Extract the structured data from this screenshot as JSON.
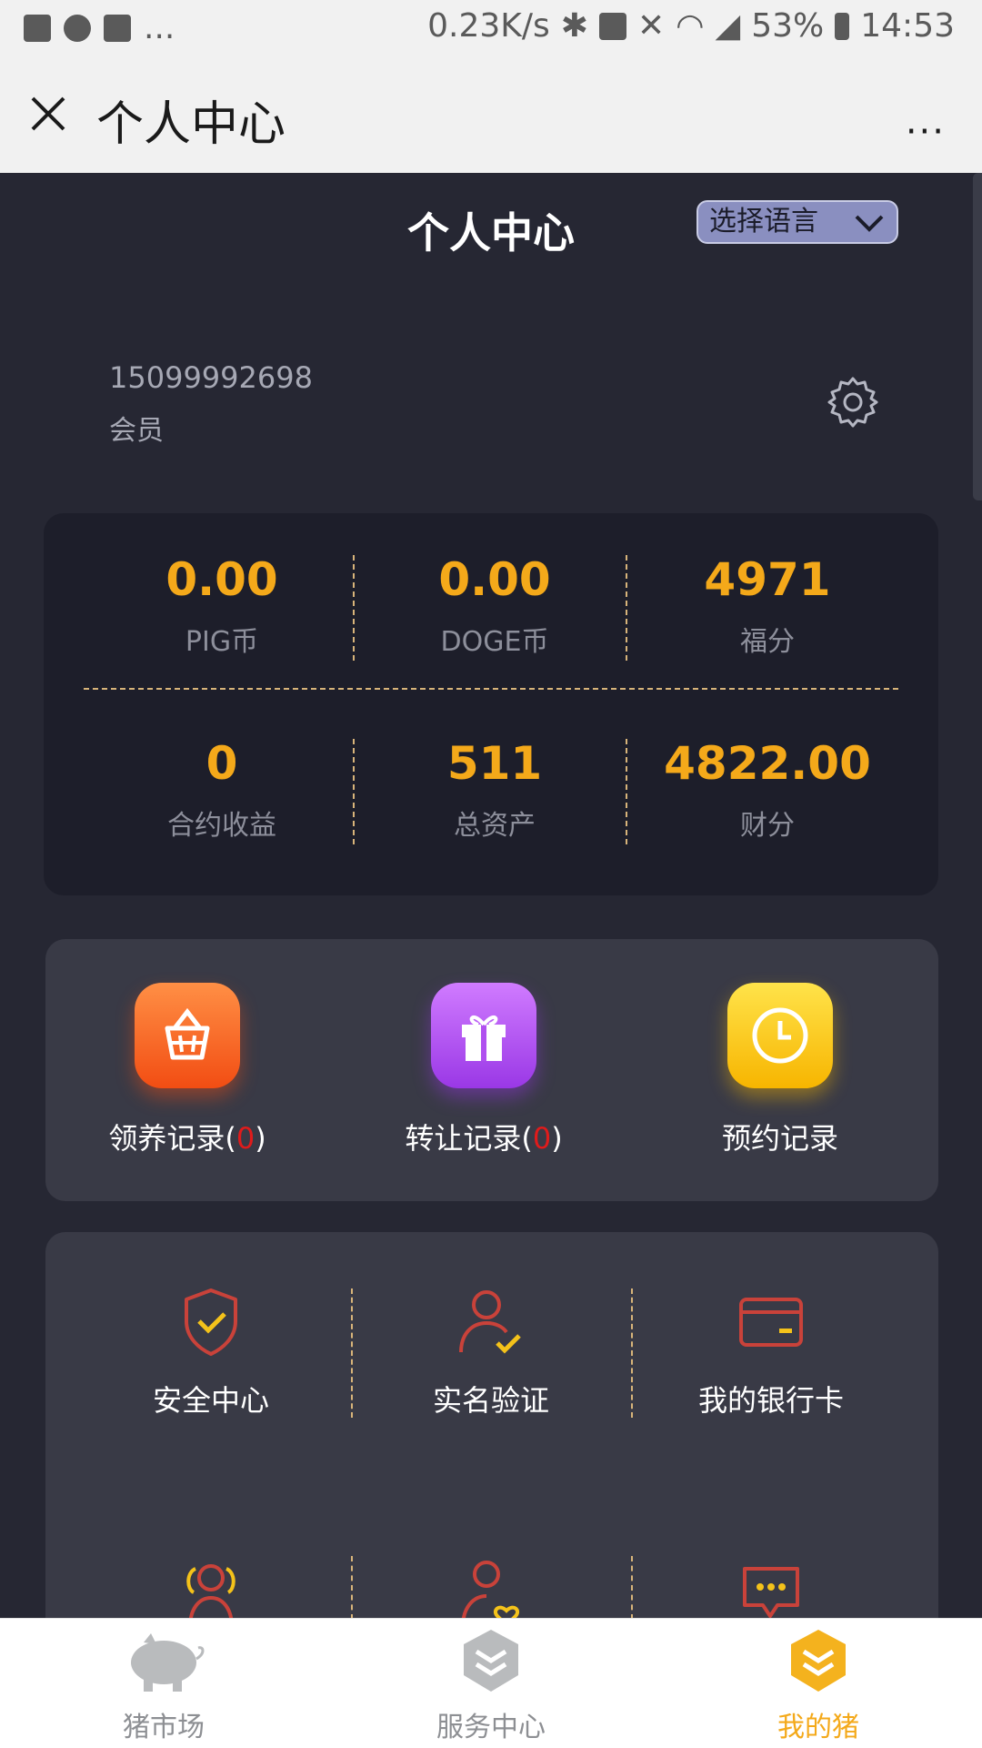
{
  "status_bar": {
    "network_speed": "0.23K/s",
    "battery": "53%",
    "time": "14:53",
    "overflow": "..."
  },
  "nav": {
    "title": "个人中心",
    "more": "···"
  },
  "header": {
    "title": "个人中心",
    "language_select": "选择语言"
  },
  "user": {
    "phone": "15099992698",
    "role": "会员"
  },
  "stats": [
    {
      "value": "0.00",
      "label": "PIG币"
    },
    {
      "value": "0.00",
      "label": "DOGE币"
    },
    {
      "value": "4971",
      "label": "福分"
    },
    {
      "value": "0",
      "label": "合约收益"
    },
    {
      "value": "511",
      "label": "总资产"
    },
    {
      "value": "4822.00",
      "label": "财分"
    }
  ],
  "records": [
    {
      "label": "领养记录",
      "count": "0",
      "icon": "basket-icon"
    },
    {
      "label": "转让记录",
      "count": "0",
      "icon": "gift-icon"
    },
    {
      "label": "预约记录",
      "icon": "clock-icon"
    }
  ],
  "services": [
    {
      "label": "安全中心",
      "icon": "shield-check-icon"
    },
    {
      "label": "实名验证",
      "icon": "user-check-icon"
    },
    {
      "label": "我的银行卡",
      "icon": "bank-card-icon"
    },
    {
      "label": "",
      "icon": "team-icon"
    },
    {
      "label": "",
      "icon": "user-heart-icon"
    },
    {
      "label": "",
      "icon": "message-icon"
    }
  ],
  "tabs": [
    {
      "label": "猪市场",
      "icon": "pig-icon",
      "active": false
    },
    {
      "label": "服务中心",
      "icon": "layers-icon",
      "active": false
    },
    {
      "label": "我的猪",
      "icon": "layers-active-icon",
      "active": true
    }
  ],
  "colors": {
    "accent": "#f4a91a",
    "background": "#262733",
    "card_dark": "#1d1e2a",
    "card": "#393a46",
    "record_count": "#e01b1b"
  }
}
